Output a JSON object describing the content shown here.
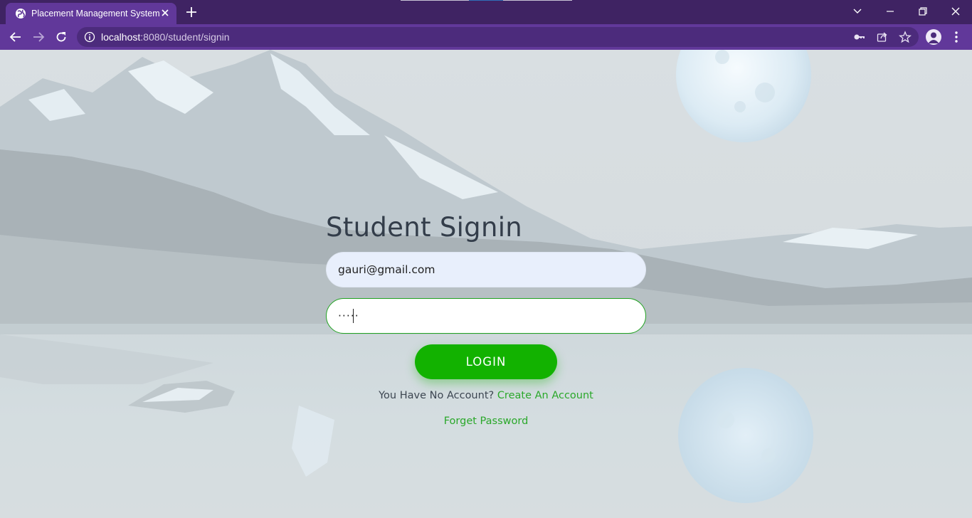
{
  "browser": {
    "tab_title": "Placement Management System",
    "url_host": "localhost",
    "url_rest": ":8080/student/signin"
  },
  "signin": {
    "title": "Student Signin",
    "email_value": "gauri@gmail.com",
    "password_value": "·····",
    "login_label": "LOGIN",
    "no_account_text": "You Have No Account? ",
    "create_account_link": "Create An Account",
    "forget_password_link": "Forget Password"
  },
  "colors": {
    "tabstrip": "#3f2363",
    "toolbar": "#61389a",
    "login_button": "#12b200",
    "link": "#2aa82a",
    "title": "#333d4a"
  },
  "icons": [
    "globe-icon",
    "close-icon",
    "plus-icon",
    "chevron-down-icon",
    "minimize-icon",
    "restore-icon",
    "window-close-icon",
    "back-arrow-icon",
    "forward-arrow-icon",
    "reload-icon",
    "info-icon",
    "key-icon",
    "share-icon",
    "star-icon",
    "profile-icon",
    "more-vert-icon"
  ]
}
